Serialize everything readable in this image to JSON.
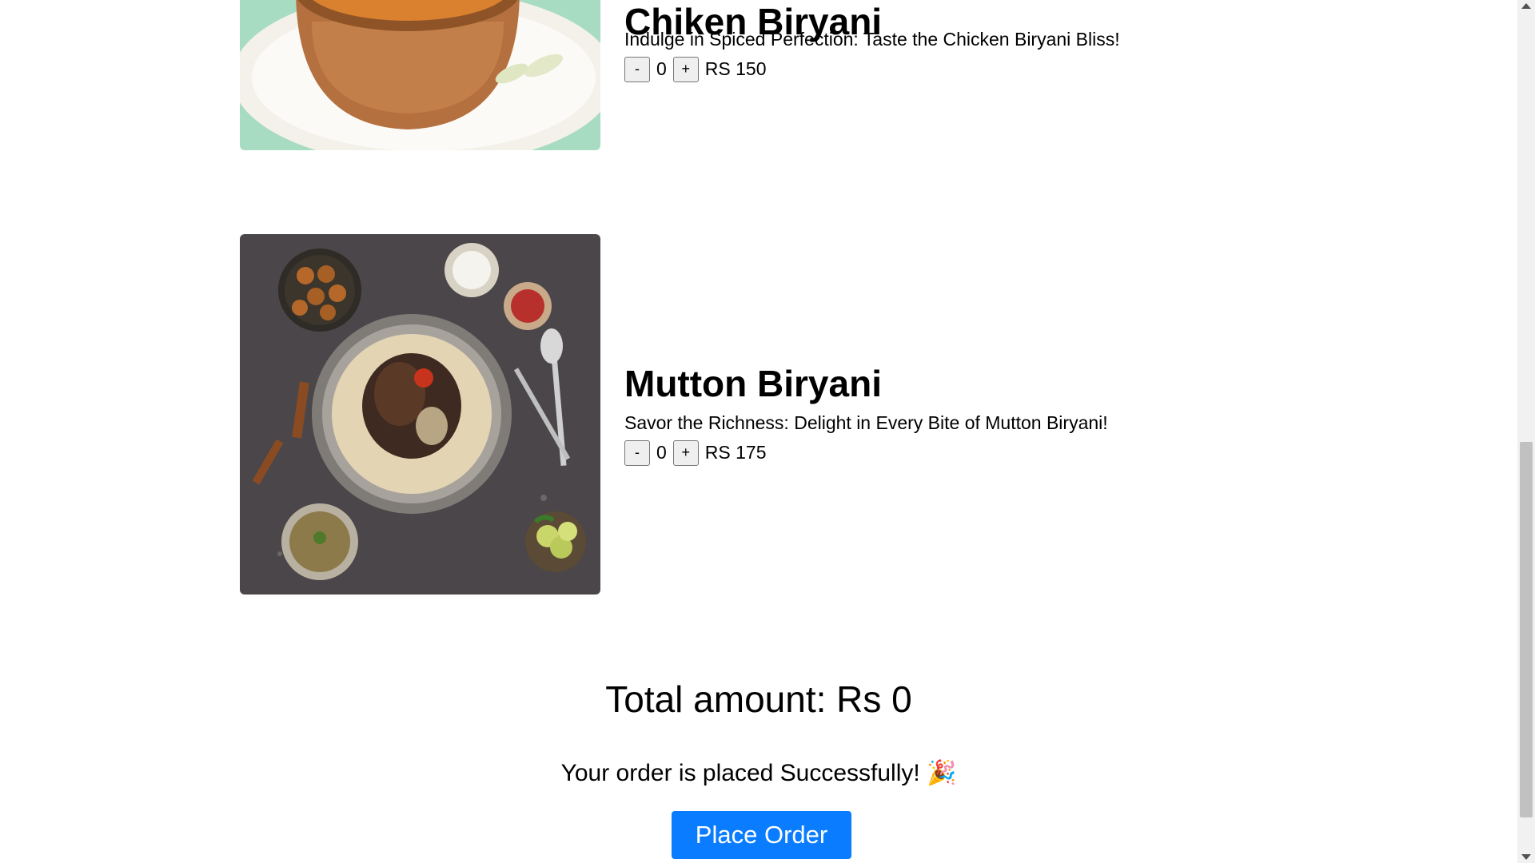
{
  "menu": {
    "items": [
      {
        "name": "Chiken Biryani",
        "description": "Indulge in Spiced Perfection: Taste the Chicken Biryani Bliss!",
        "quantity": "0",
        "decrement_label": "-",
        "increment_label": "+",
        "price": "RS 150",
        "image_icon": "chicken-biryani-photo"
      },
      {
        "name": "Mutton Biryani",
        "description": "Savor the Richness: Delight in Every Bite of Mutton Biryani!",
        "quantity": "0",
        "decrement_label": "-",
        "increment_label": "+",
        "price": "RS 175",
        "image_icon": "mutton-biryani-photo"
      }
    ]
  },
  "order": {
    "total_text": "Total amount: Rs 0",
    "success_text": "Your order is placed Successfully! 🎉",
    "place_order_label": "Place Order"
  },
  "colors": {
    "primary_button": "#0a7cff",
    "page_background": "#ffffff"
  }
}
